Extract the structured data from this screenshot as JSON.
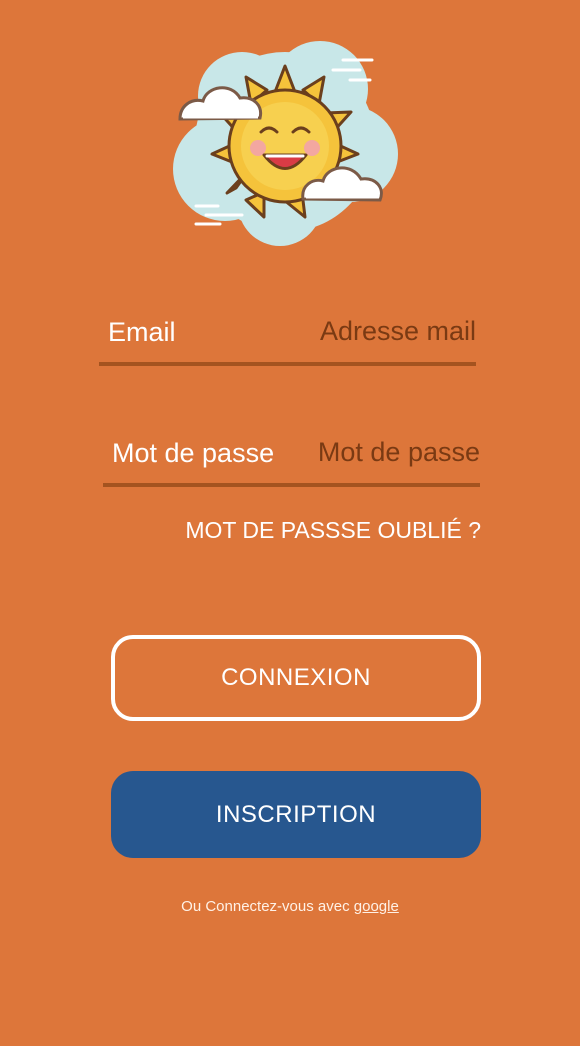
{
  "login": {
    "email": {
      "label": "Email",
      "placeholder": "Adresse mail",
      "value": ""
    },
    "password": {
      "label": "Mot de passe",
      "placeholder": "Mot de passe",
      "value": ""
    },
    "forgot_password": "MOT DE PASSSE OUBLIÉ ?",
    "connexion_button": "CONNEXION",
    "inscription_button": "INSCRIPTION",
    "social": {
      "prefix": "Ou Connectez-vous avec",
      "link": "google"
    }
  },
  "logo": {
    "icon": "smiling-sun-with-clouds-icon"
  },
  "colors": {
    "background": "#DD763A",
    "field_underline": "#A4531F",
    "placeholder_text": "#7A3A13",
    "inscription_button": "#27578F",
    "text": "#FFFFFF",
    "logo_cloud": "#C8E7E8",
    "sun": "#F5C33B",
    "sun_outline": "#6B3F1D"
  }
}
